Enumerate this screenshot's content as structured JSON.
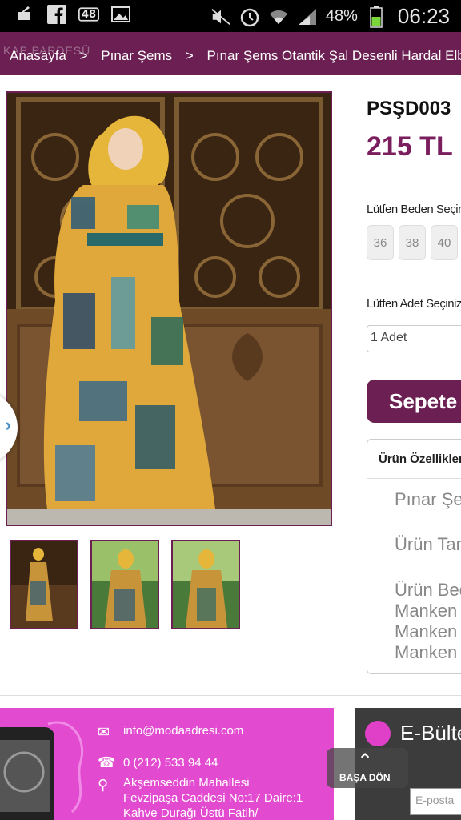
{
  "status_bar": {
    "icons": [
      "cleaner-icon",
      "facebook-icon",
      "notification-count-icon",
      "gallery-icon",
      "mute-icon",
      "alarm-icon",
      "wifi-icon",
      "signal-icon",
      "battery-icon"
    ],
    "notification_count": "48",
    "battery": "48%",
    "time": "06:23"
  },
  "nav": {
    "ghost_text": "KAP PARDESÜ",
    "breadcrumb": [
      "Anasayfa",
      "Pınar Şems",
      "Pınar Şems Otantik Şal Desenli Hardal Elbise"
    ],
    "separator": ">"
  },
  "product": {
    "code": "PSŞD003",
    "price": "215 TL",
    "size_label": "Lütfen Beden Seçin",
    "sizes": [
      "36",
      "38",
      "40"
    ],
    "quantity_label": "Lütfen Adet Seçiniz",
    "quantity_value": "1 Adet",
    "cart_button": "Sepete e",
    "features_title": "Ürün Özellikleri",
    "features": [
      "Pınar Şem",
      "Ürün Tan",
      "Ürün Bed",
      "Manken",
      "Manken",
      "Manken"
    ]
  },
  "gallery": {
    "thumbnail_count": 3
  },
  "footer": {
    "email": "info@modaadresi.com",
    "phone": "0 (212) 533 94 44",
    "address_lines": [
      "Akşemseddin Mahallesi",
      "Fevzipaşa Caddesi No:17 Daire:1",
      "Kahve Durağı Üstü Fatih/"
    ],
    "newsletter_title": "E-Bülte",
    "newsletter_placeholder": "E-posta",
    "back_to_top": "BAŞA DÖN"
  },
  "colors": {
    "brand": "#6b1f52",
    "footer_pink": "#e24ad0",
    "price": "#7a1e5e"
  }
}
